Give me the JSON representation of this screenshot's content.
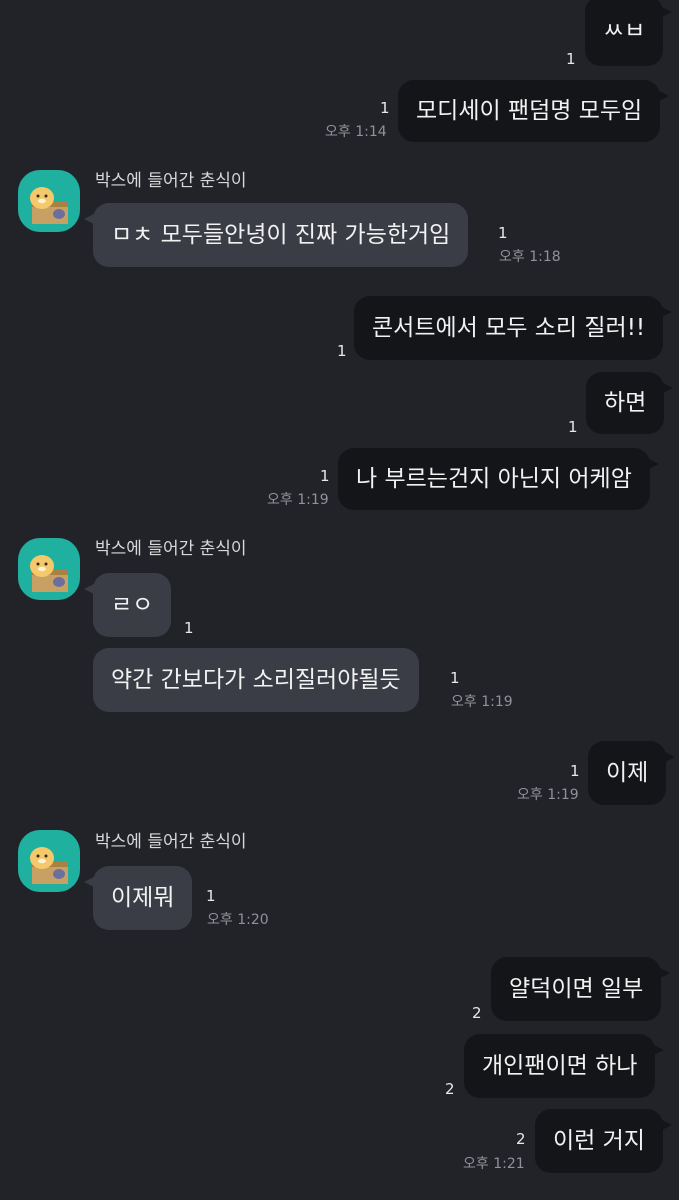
{
  "sender_name": "박스에 들어간 춘식이",
  "messages": [
    {
      "text": "ㅆㅂ",
      "read": "1"
    },
    {
      "text": "모디세이 팬덤명 모두임",
      "read": "1",
      "time": "오후 1:14"
    },
    {
      "text": "ㅁㅊ 모두들안녕이 진짜 가능한거임",
      "read": "1",
      "time": "오후 1:18"
    },
    {
      "text": "콘서트에서 모두 소리 질러!!",
      "read": "1"
    },
    {
      "text": "하면",
      "read": "1"
    },
    {
      "text": "나 부르는건지 아닌지 어케암",
      "read": "1",
      "time": "오후 1:19"
    },
    {
      "text": "ㄹㅇ",
      "read": "1"
    },
    {
      "text": "약간 간보다가 소리질러야될듯",
      "read": "1",
      "time": "오후 1:19"
    },
    {
      "text": "이제",
      "read": "1",
      "time": "오후 1:19"
    },
    {
      "text": "이제뭐",
      "read": "1",
      "time": "오후 1:20"
    },
    {
      "text": "얄덕이면 일부",
      "read": "2"
    },
    {
      "text": "개인팬이면 하나",
      "read": "2"
    },
    {
      "text": "이런 거지",
      "read": "2",
      "time": "오후 1:21"
    }
  ]
}
